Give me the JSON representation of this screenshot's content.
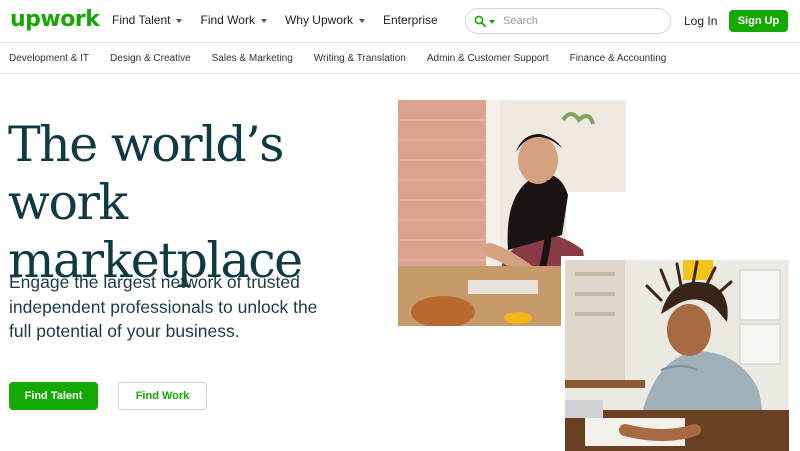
{
  "brand": {
    "logo_text": "upwork",
    "color": "#14a800",
    "dark_text": "#0f3a44"
  },
  "header": {
    "nav": [
      {
        "label": "Find Talent",
        "has_dropdown": true
      },
      {
        "label": "Find Work",
        "has_dropdown": true
      },
      {
        "label": "Why Upwork",
        "has_dropdown": true
      },
      {
        "label": "Enterprise",
        "has_dropdown": false
      }
    ],
    "search": {
      "placeholder": "Search",
      "icon": "search-icon"
    },
    "login_label": "Log In",
    "signup_label": "Sign Up"
  },
  "categories": [
    "Development & IT",
    "Design & Creative",
    "Sales & Marketing",
    "Writing & Translation",
    "Admin & Customer Support",
    "Finance & Accounting"
  ],
  "hero": {
    "headline_line1": "The world’s work",
    "headline_line2": "marketplace",
    "subhead": "Engage the largest network of trusted independent professionals to unlock the full potential of your business.",
    "primary_cta": "Find Talent",
    "secondary_cta": "Find Work"
  }
}
